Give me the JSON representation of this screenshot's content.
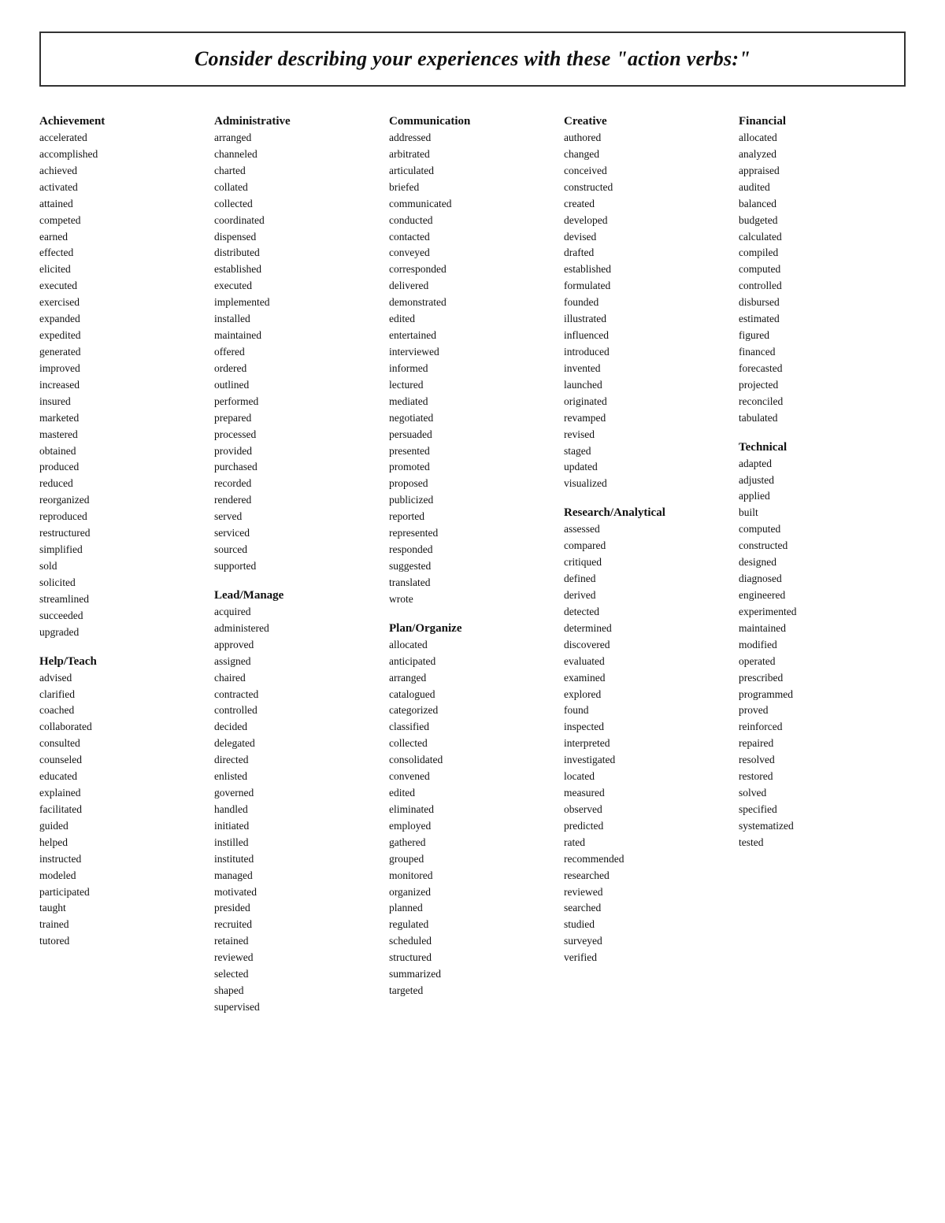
{
  "header": {
    "title": "Consider describing your experiences with these \"action verbs:\""
  },
  "columns": [
    {
      "id": "achievement",
      "categories": [
        {
          "title": "Achievement",
          "words": [
            "accelerated",
            "accomplished",
            "achieved",
            "activated",
            "attained",
            "competed",
            "earned",
            "effected",
            "elicited",
            "executed",
            "exercised",
            "expanded",
            "expedited",
            "generated",
            "improved",
            "increased",
            "insured",
            "marketed",
            "mastered",
            "obtained",
            "produced",
            "reduced",
            "reorganized",
            "reproduced",
            "restructured",
            "simplified",
            "sold",
            "solicited",
            "streamlined",
            "succeeded",
            "upgraded"
          ]
        },
        {
          "title": "Help/Teach",
          "words": [
            "advised",
            "clarified",
            "coached",
            "collaborated",
            "consulted",
            "counseled",
            "educated",
            "explained",
            "facilitated",
            "guided",
            "helped",
            "instructed",
            "modeled",
            "participated",
            "taught",
            "trained",
            "tutored"
          ]
        }
      ]
    },
    {
      "id": "administrative",
      "categories": [
        {
          "title": "Administrative",
          "words": [
            "arranged",
            "channeled",
            "charted",
            "collated",
            "collected",
            "coordinated",
            "dispensed",
            "distributed",
            "established",
            "executed",
            "implemented",
            "installed",
            "maintained",
            "offered",
            "ordered",
            "outlined",
            "performed",
            "prepared",
            "processed",
            "provided",
            "purchased",
            "recorded",
            "rendered",
            "served",
            "serviced",
            "sourced",
            "supported"
          ]
        },
        {
          "title": "Lead/Manage",
          "words": [
            "acquired",
            "administered",
            "approved",
            "assigned",
            "chaired",
            "contracted",
            "controlled",
            "decided",
            "delegated",
            "directed",
            "enlisted",
            "governed",
            "handled",
            "initiated",
            "instilled",
            "instituted",
            "managed",
            "motivated",
            "presided",
            "recruited",
            "retained",
            "reviewed",
            "selected",
            "shaped",
            "supervised"
          ]
        }
      ]
    },
    {
      "id": "communication",
      "categories": [
        {
          "title": "Communication",
          "words": [
            "addressed",
            "arbitrated",
            "articulated",
            "briefed",
            "communicated",
            "conducted",
            "contacted",
            "conveyed",
            "corresponded",
            "delivered",
            "demonstrated",
            "edited",
            "entertained",
            "interviewed",
            "informed",
            "lectured",
            "mediated",
            "negotiated",
            "persuaded",
            "presented",
            "promoted",
            "proposed",
            "publicized",
            "reported",
            "represented",
            "responded",
            "suggested",
            "translated",
            "wrote"
          ]
        },
        {
          "title": "Plan/Organize",
          "words": [
            "allocated",
            "anticipated",
            "arranged",
            "catalogued",
            "categorized",
            "classified",
            "collected",
            "consolidated",
            "convened",
            "edited",
            "eliminated",
            "employed",
            "gathered",
            "grouped",
            "monitored",
            "organized",
            "planned",
            "regulated",
            "scheduled",
            "structured",
            "summarized",
            "targeted"
          ]
        }
      ]
    },
    {
      "id": "creative",
      "categories": [
        {
          "title": "Creative",
          "words": [
            "authored",
            "changed",
            "conceived",
            "constructed",
            "created",
            "developed",
            "devised",
            "drafted",
            "established",
            "formulated",
            "founded",
            "illustrated",
            "influenced",
            "introduced",
            "invented",
            "launched",
            "originated",
            "revamped",
            "revised",
            "staged",
            "updated",
            "visualized"
          ]
        },
        {
          "title": "Research/Analytical",
          "words": [
            "assessed",
            "compared",
            "critiqued",
            "defined",
            "derived",
            "detected",
            "determined",
            "discovered",
            "evaluated",
            "examined",
            "explored",
            "found",
            "inspected",
            "interpreted",
            "investigated",
            "located",
            "measured",
            "observed",
            "predicted",
            "rated",
            "recommended",
            "researched",
            "reviewed",
            "searched",
            "studied",
            "surveyed",
            "verified"
          ]
        }
      ]
    },
    {
      "id": "financial",
      "categories": [
        {
          "title": "Financial",
          "words": [
            "allocated",
            "analyzed",
            "appraised",
            "audited",
            "balanced",
            "budgeted",
            "calculated",
            "compiled",
            "computed",
            "controlled",
            "disbursed",
            "estimated",
            "figured",
            "financed",
            "forecasted",
            "projected",
            "reconciled",
            "tabulated"
          ]
        },
        {
          "title": "Technical",
          "words": [
            "adapted",
            "adjusted",
            "applied",
            "built",
            "computed",
            "constructed",
            "designed",
            "diagnosed",
            "engineered",
            "experimented",
            "maintained",
            "modified",
            "operated",
            "prescribed",
            "programmed",
            "proved",
            "reinforced",
            "repaired",
            "resolved",
            "restored",
            "solved",
            "specified",
            "systematized",
            "tested"
          ]
        }
      ]
    }
  ]
}
